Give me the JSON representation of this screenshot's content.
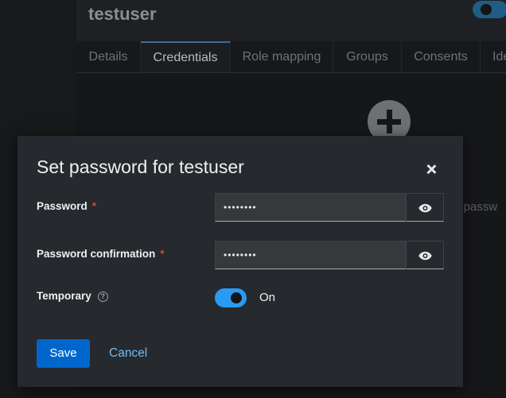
{
  "background": {
    "user_title": "testuser",
    "enabled_toggle": true,
    "tabs": [
      {
        "label": "Details",
        "active": false
      },
      {
        "label": "Credentials",
        "active": true
      },
      {
        "label": "Role mapping",
        "active": false
      },
      {
        "label": "Groups",
        "active": false
      },
      {
        "label": "Consents",
        "active": false
      },
      {
        "label": "Ide",
        "active": false
      }
    ],
    "partial_text": "et passw"
  },
  "modal": {
    "title": "Set password for testuser",
    "password": {
      "label": "Password",
      "required_marker": "*",
      "value": "••••••••"
    },
    "password_confirmation": {
      "label": "Password confirmation",
      "required_marker": "*",
      "value": "••••••••"
    },
    "temporary": {
      "label": "Temporary",
      "help_glyph": "?",
      "state_label": "On",
      "enabled": true
    },
    "save_label": "Save",
    "cancel_label": "Cancel"
  },
  "colors": {
    "primary": "#0066cc",
    "link": "#73bcf7",
    "switch_on": "#2b9af3",
    "required": "#e0443d",
    "modal_bg": "#26292d"
  }
}
